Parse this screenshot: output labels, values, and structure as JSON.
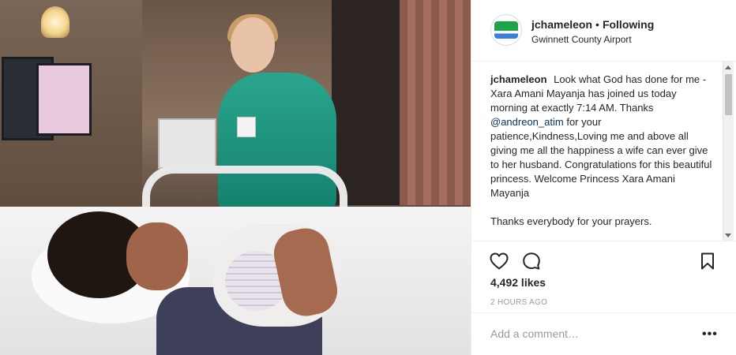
{
  "post": {
    "image": {
      "alt": "Photo of a mother holding her newborn baby in a hospital bed with a nurse standing behind"
    },
    "header": {
      "username": "jchameleon",
      "separator": "•",
      "follow_status": "Following",
      "location": "Gwinnett County Airport",
      "avatar_icon": "champions-logo-icon"
    },
    "caption": {
      "username": "jchameleon",
      "text_before_mention": "Look what God has done for me - Xara Amani Mayanja has joined us today morning at exactly 7:14 AM. Thanks",
      "mention": "@andreon_atim",
      "text_after_mention": "for your patience,Kindness,Loving me and above all giving me all the happiness a wife can ever give to her husband. Congratulations for this beautiful princess. Welcome Princess Xara Amani Mayanja",
      "second_paragraph": "Thanks everybody for your prayers."
    },
    "actions": {
      "like_icon": "heart-icon",
      "comment_icon": "comment-bubble-icon",
      "save_icon": "bookmark-icon"
    },
    "likes_text": "4,492 likes",
    "timestamp": "2 HOURS AGO",
    "comment_box": {
      "placeholder": "Add a comment…",
      "more_label": "•••"
    }
  }
}
